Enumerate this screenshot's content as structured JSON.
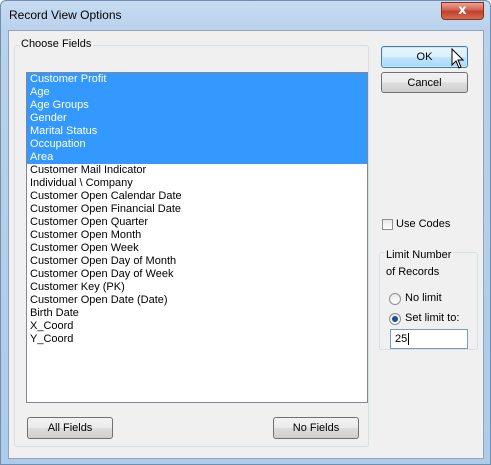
{
  "window": {
    "title": "Record View Options",
    "close_glyph": "x"
  },
  "fields_group": {
    "label": "Choose Fields",
    "items": [
      {
        "label": "Customer Profit",
        "selected": true
      },
      {
        "label": "Age",
        "selected": true
      },
      {
        "label": "Age Groups",
        "selected": true
      },
      {
        "label": "Gender",
        "selected": true
      },
      {
        "label": "Marital Status",
        "selected": true
      },
      {
        "label": "Occupation",
        "selected": true
      },
      {
        "label": "Area",
        "selected": true
      },
      {
        "label": "Customer Mail Indicator",
        "selected": false
      },
      {
        "label": "Individual \\ Company",
        "selected": false
      },
      {
        "label": "Customer Open Calendar Date",
        "selected": false
      },
      {
        "label": "Customer Open Financial Date",
        "selected": false
      },
      {
        "label": "Customer Open Quarter",
        "selected": false
      },
      {
        "label": "Customer Open Month",
        "selected": false
      },
      {
        "label": "Customer Open Week",
        "selected": false
      },
      {
        "label": "Customer Open Day of Month",
        "selected": false
      },
      {
        "label": "Customer Open Day of Week",
        "selected": false
      },
      {
        "label": "Customer Key (PK)",
        "selected": false
      },
      {
        "label": "Customer Open Date (Date)",
        "selected": false
      },
      {
        "label": "Birth Date",
        "selected": false
      },
      {
        "label": "X_Coord",
        "selected": false
      },
      {
        "label": "Y_Coord",
        "selected": false
      }
    ],
    "all_fields_label": "All Fields",
    "no_fields_label": "No Fields"
  },
  "buttons": {
    "ok_label": "OK",
    "cancel_label": "Cancel"
  },
  "use_codes": {
    "label": "Use Codes",
    "checked": false
  },
  "limit_group": {
    "label_line1": "Limit Number",
    "label_line2": "of Records",
    "no_limit_label": "No limit",
    "set_limit_label": "Set limit to:",
    "limit_value": "25",
    "selected": "set_limit"
  },
  "colors": {
    "selection": "#3399ff",
    "title_bar": "#b9d1ec",
    "close_button": "#c7503a"
  },
  "icons": {
    "close": "close-icon",
    "cursor": "mouse-pointer-icon",
    "radio_dot": "radio-dot-icon"
  }
}
